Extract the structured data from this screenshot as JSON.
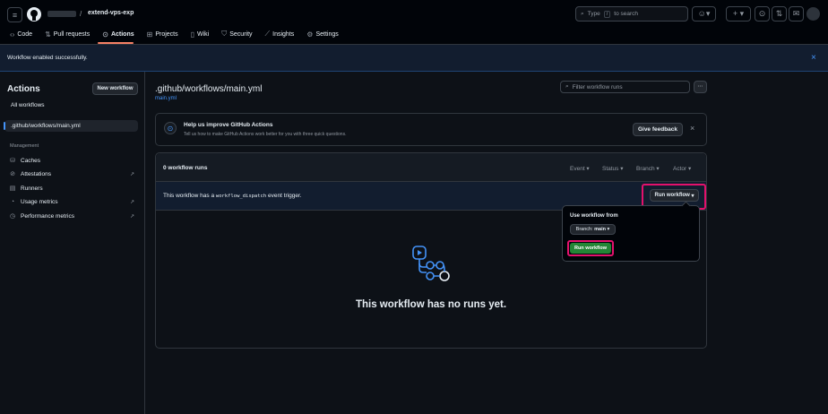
{
  "header": {
    "repo_name": "extend-vps-exp",
    "separator": "/",
    "search_placeholder": "Type / to search",
    "search_prefix": "Type",
    "search_suffix": "to search",
    "search_key": "/"
  },
  "tabs": [
    {
      "label": "Code",
      "icon": "code-icon"
    },
    {
      "label": "Pull requests",
      "icon": "pull-request-icon"
    },
    {
      "label": "Actions",
      "icon": "play-icon"
    },
    {
      "label": "Projects",
      "icon": "table-icon"
    },
    {
      "label": "Wiki",
      "icon": "book-icon"
    },
    {
      "label": "Security",
      "icon": "shield-icon"
    },
    {
      "label": "Insights",
      "icon": "graph-icon"
    },
    {
      "label": "Settings",
      "icon": "gear-icon"
    }
  ],
  "banner": {
    "message": "Workflow enabled successfully.",
    "close": "×"
  },
  "sidebar": {
    "title": "Actions",
    "new_workflow": "New workflow",
    "all_workflows": "All workflows",
    "selected_workflow": ".github/workflows/main.yml",
    "management_heading": "Management",
    "management_items": [
      {
        "label": "Caches",
        "icon": "database-icon",
        "external": false
      },
      {
        "label": "Attestations",
        "icon": "verified-icon",
        "external": true
      },
      {
        "label": "Runners",
        "icon": "server-icon",
        "external": false
      },
      {
        "label": "Usage metrics",
        "icon": "meter-icon",
        "external": true
      },
      {
        "label": "Performance metrics",
        "icon": "pulse-icon",
        "external": true
      }
    ],
    "external_arrow": "↗"
  },
  "main": {
    "title": ".github/workflows/main.yml",
    "file_link": "main.yml",
    "filter_placeholder": "Filter workflow runs",
    "more": "···",
    "feedback": {
      "title": "Help us improve GitHub Actions",
      "subtitle": "Tell us how to make GitHub Actions work better for you with three quick questions.",
      "button": "Give feedback",
      "close": "×"
    },
    "runs_count": "0 workflow runs",
    "filters": [
      "Event",
      "Status",
      "Branch",
      "Actor"
    ],
    "trigger_prefix": "This workflow has a",
    "trigger_code": "workflow_dispatch",
    "trigger_suffix": "event trigger.",
    "run_workflow_button": "Run workflow",
    "empty_message": "This workflow has no runs yet."
  },
  "dropdown": {
    "label": "Use workflow from",
    "branch_prefix": "Branch:",
    "branch_value": "main",
    "run_button": "Run workflow"
  },
  "colors": {
    "accent": "#4493f8",
    "highlight": "#e3116c",
    "green": "#238636"
  }
}
